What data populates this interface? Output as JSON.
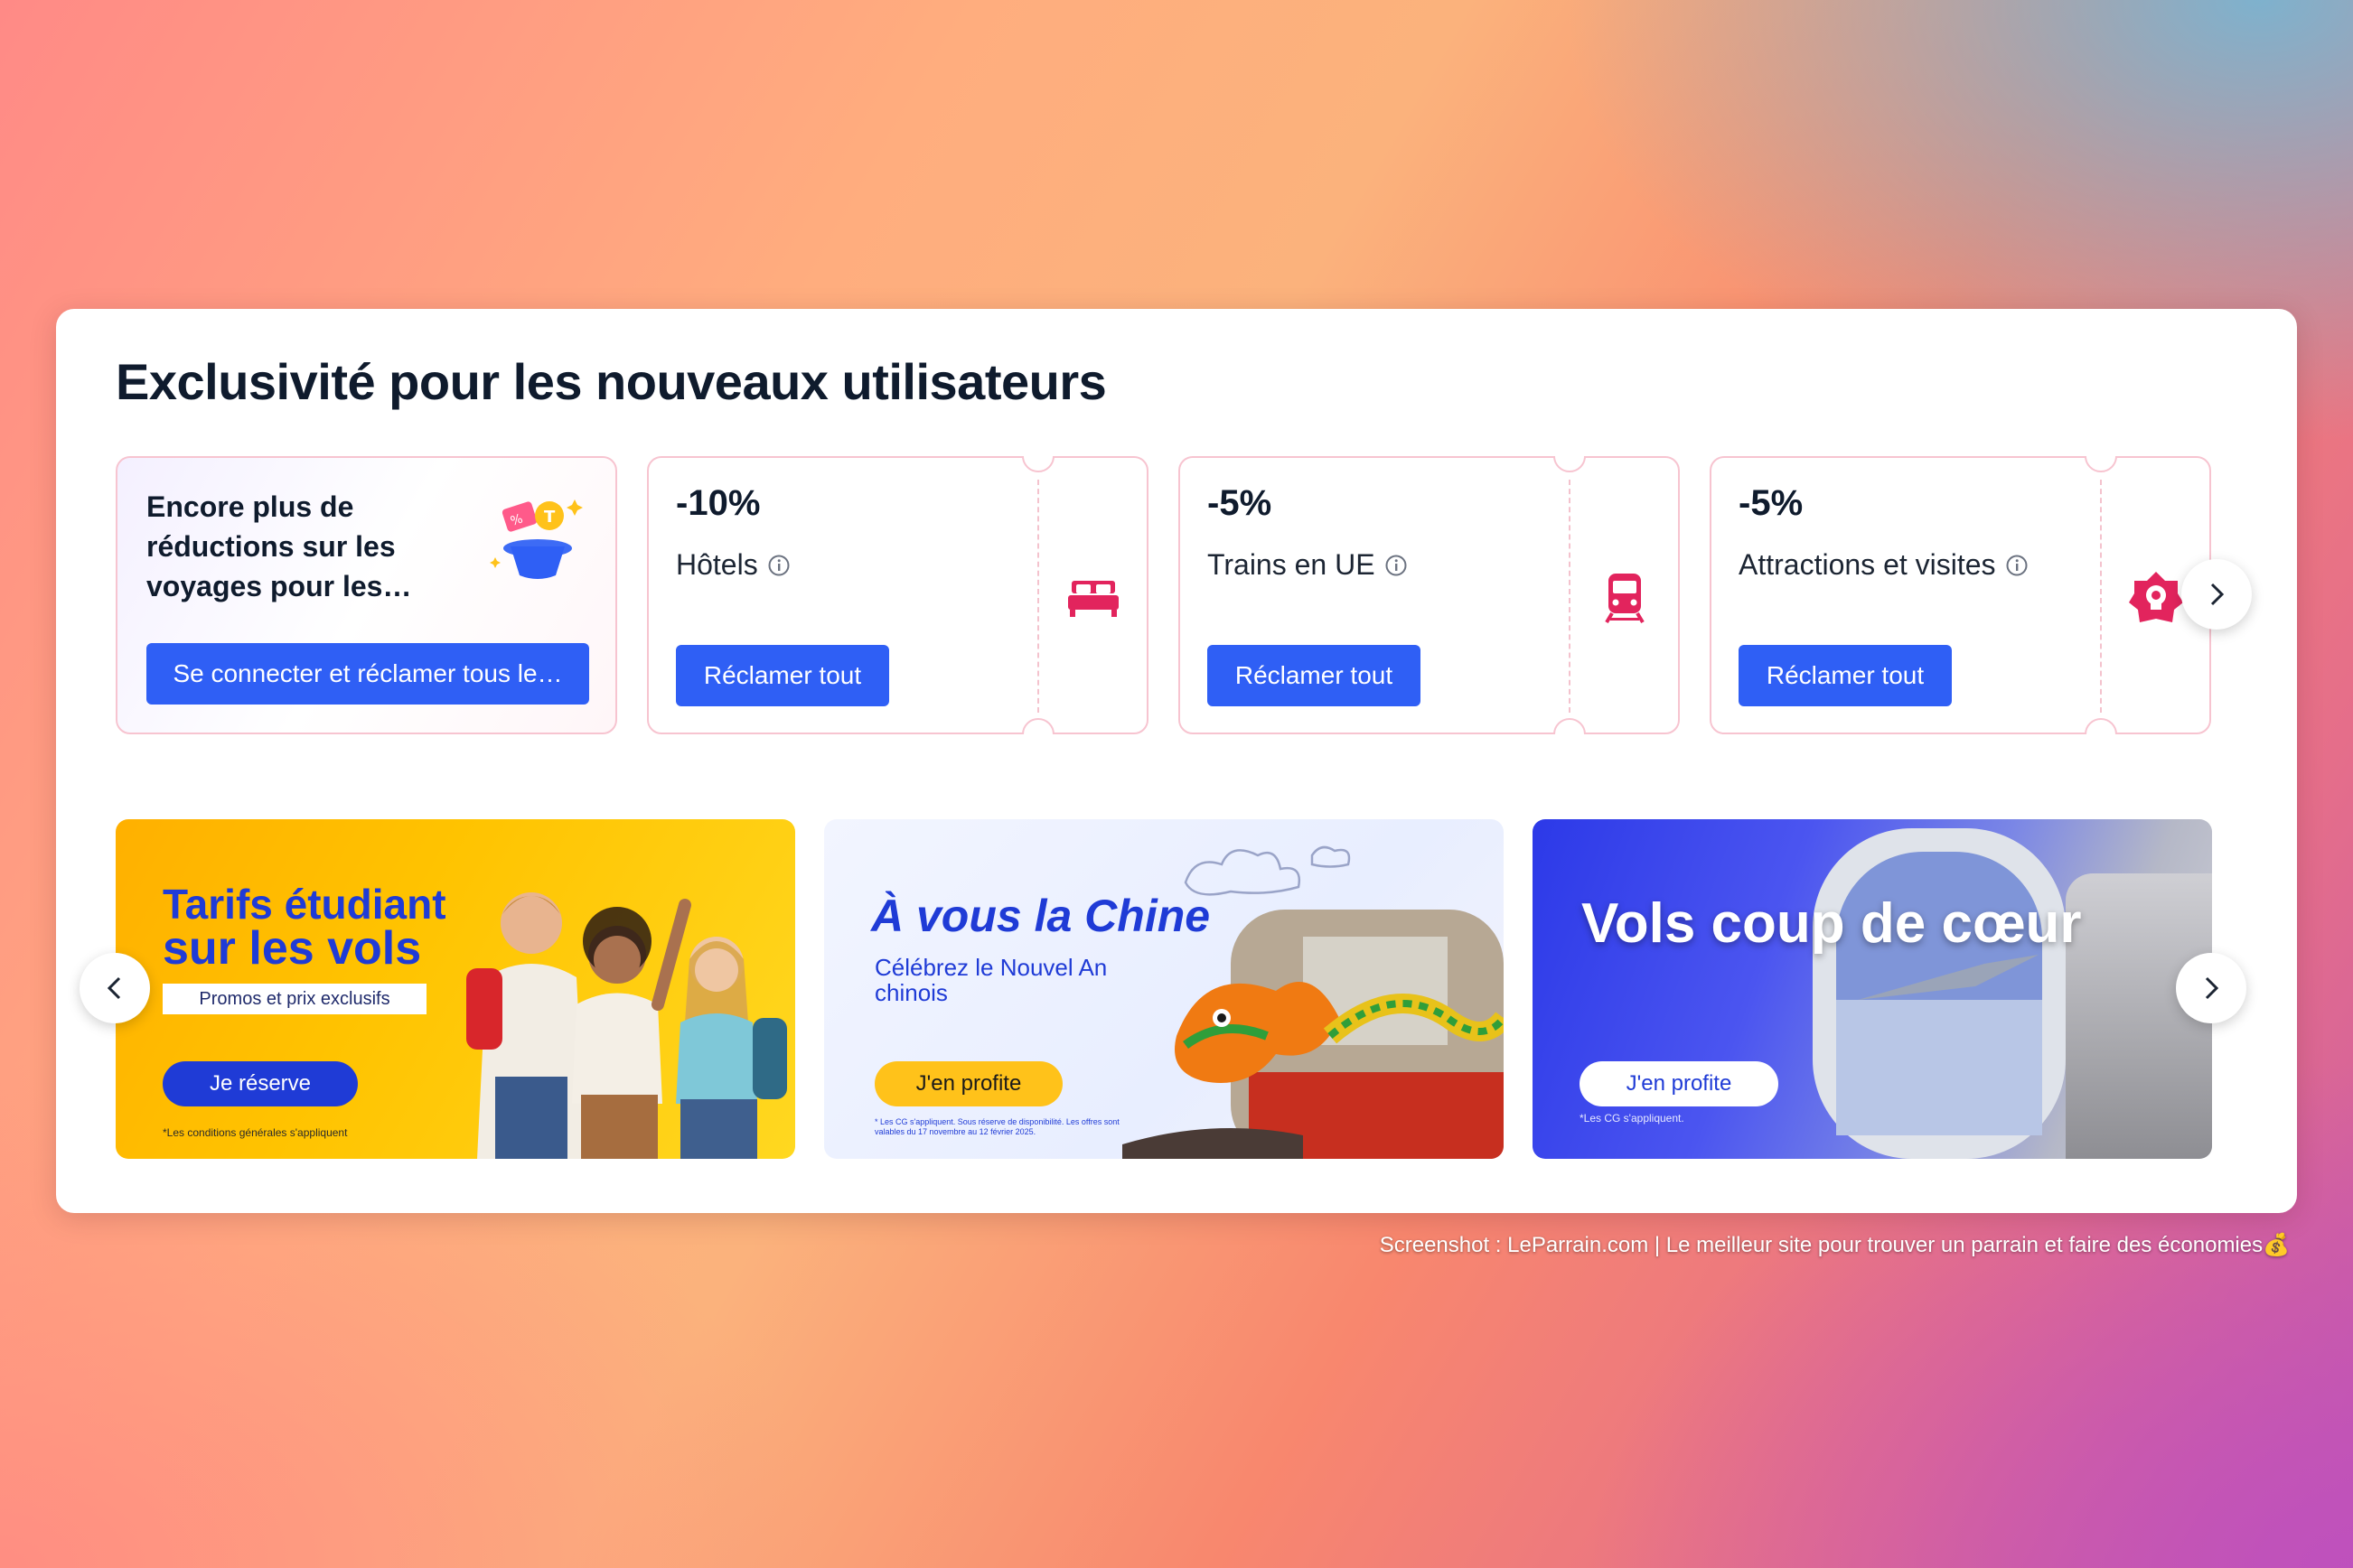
{
  "section": {
    "title": "Exclusivité pour les nouveaux utilisateurs"
  },
  "login_card": {
    "text": "Encore plus de réductions sur les voyages pour les…",
    "button": "Se connecter et réclamer tous le…"
  },
  "coupons": [
    {
      "discount": "-10%",
      "category": "Hôtels",
      "button": "Réclamer tout",
      "icon": "bed-icon"
    },
    {
      "discount": "-5%",
      "category": "Trains en UE",
      "button": "Réclamer tout",
      "icon": "train-icon"
    },
    {
      "discount": "-5%",
      "category": "Attractions et visites",
      "button": "Réclamer tout",
      "icon": "attraction-icon"
    }
  ],
  "banners": [
    {
      "title_line1": "Tarifs étudiant",
      "title_line2": "sur les vols",
      "tag": "Promos et prix exclusifs",
      "button": "Je réserve",
      "legal": "*Les conditions générales s'appliquent"
    },
    {
      "title": "À vous la Chine",
      "subtitle": "Célébrez le Nouvel An chinois",
      "button": "J'en profite",
      "legal": "* Les CG s'appliquent. Sous réserve de disponibilité. Les offres sont valables du 17 novembre au 12 février 2025."
    },
    {
      "title": "Vols coup de cœur",
      "button": "J'en profite",
      "legal": "*Les CG s'appliquent."
    }
  ],
  "watermark": "Screenshot : LeParrain.com | Le meilleur site pour trouver un parrain et faire des économies💰",
  "colors": {
    "accent": "#2f5ff5",
    "icon_pink": "#e2245d",
    "card_border": "#f7c4d0"
  }
}
